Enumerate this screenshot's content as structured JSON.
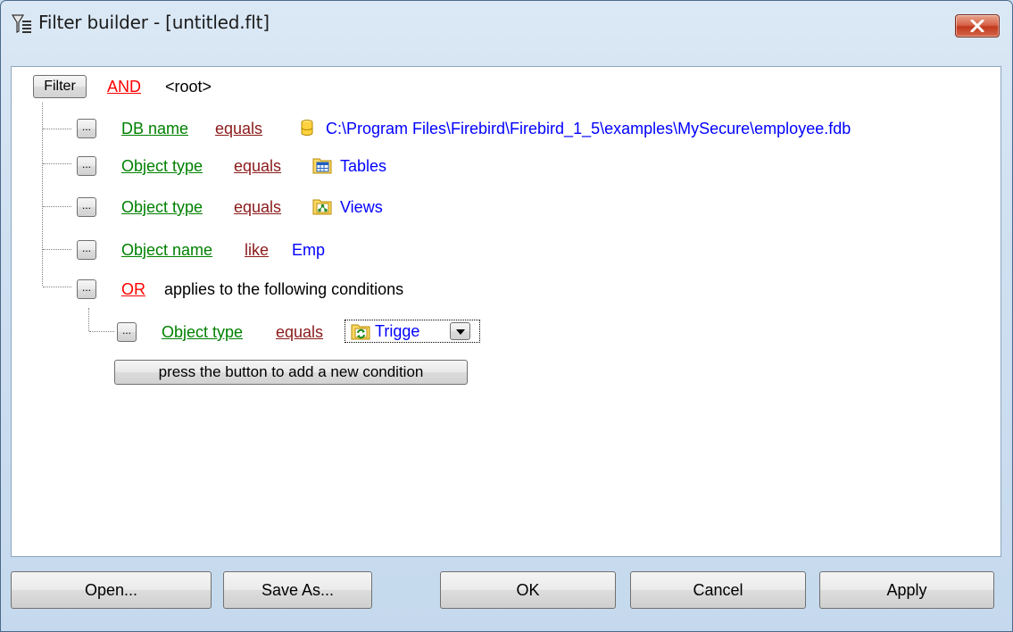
{
  "window": {
    "title": "Filter builder - [untitled.flt]"
  },
  "root": {
    "filter_button": "Filter",
    "operator": "AND",
    "label": "<root>"
  },
  "conditions": [
    {
      "field": "DB name",
      "op": "equals",
      "value": "C:\\Program Files\\Firebird\\Firebird_1_5\\examples\\MySecure\\employee.fdb",
      "icon": "database-icon"
    },
    {
      "field": "Object type",
      "op": "equals",
      "value": "Tables",
      "icon": "tables-icon"
    },
    {
      "field": "Object type",
      "op": "equals",
      "value": "Views",
      "icon": "views-icon"
    },
    {
      "field": "Object name",
      "op": "like",
      "value": "Emp"
    }
  ],
  "or_group": {
    "operator": "OR",
    "label": "applies to the following conditions",
    "condition": {
      "field": "Object type",
      "op": "equals",
      "value": "Trigge",
      "icon": "triggers-icon"
    }
  },
  "ellipsis": "...",
  "add_condition_label": "press the button to add a new condition",
  "footer": {
    "open": "Open...",
    "save_as": "Save As...",
    "ok": "OK",
    "cancel": "Cancel",
    "apply": "Apply"
  },
  "colors": {
    "field": "#008000",
    "operator": "#8b1a1a",
    "group": "#ff0000",
    "value": "#0000ff"
  }
}
